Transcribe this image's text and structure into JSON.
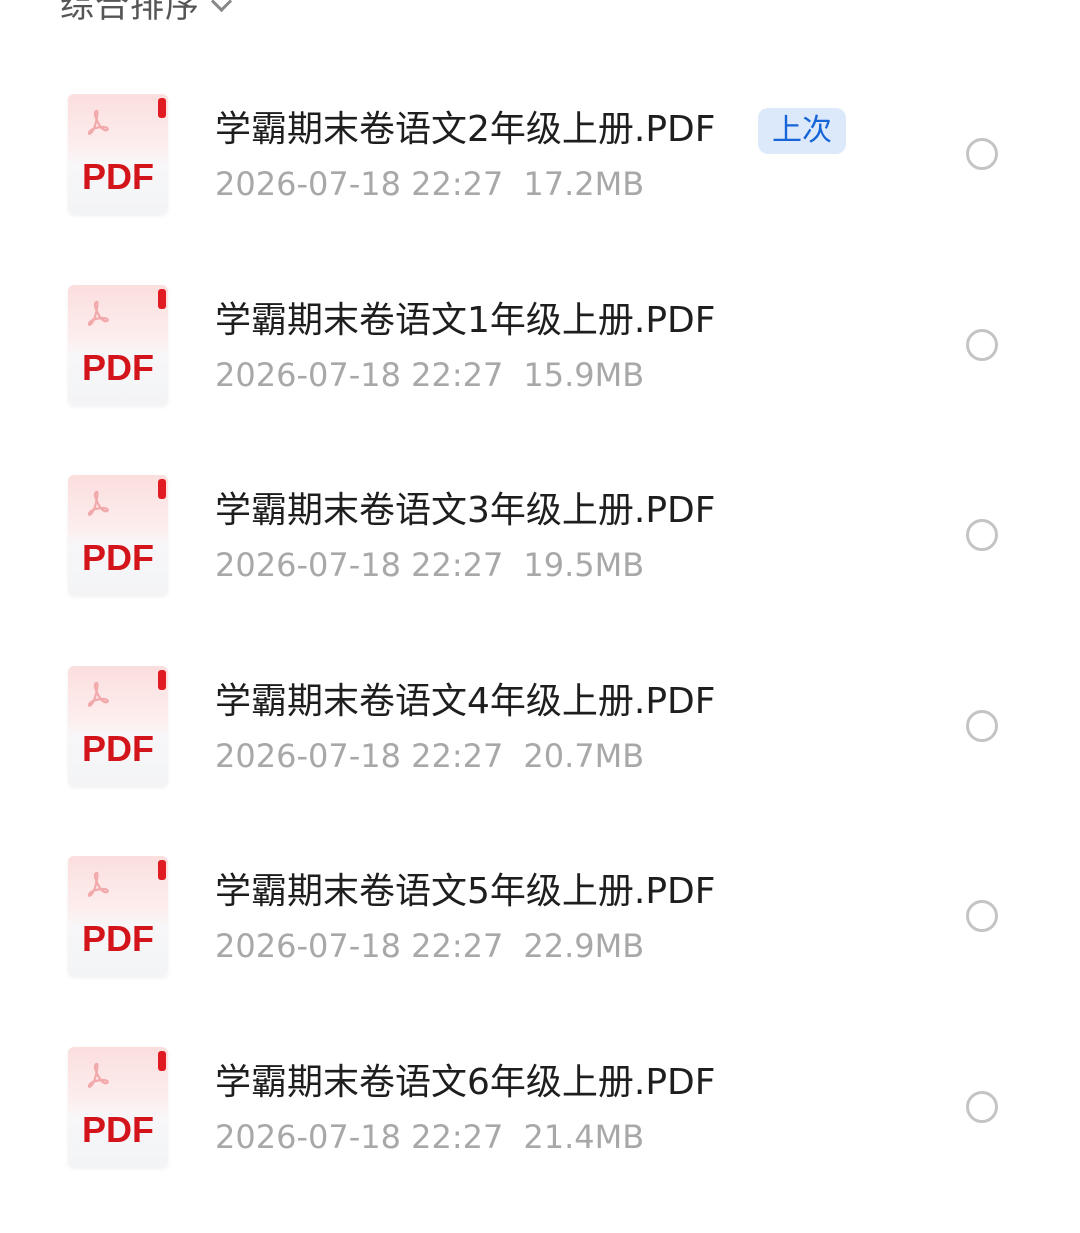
{
  "header": {
    "sort_label": "综合排序",
    "sort_chevron_icon": "chevron-down-icon",
    "view_toggle_icon": "grid-view-icon"
  },
  "files": [
    {
      "name": "学霸期末卷语文2年级上册.PDF",
      "date": "2026-07-18 22:27",
      "size": "17.2MB",
      "badge": "上次",
      "icon": "pdf-file-icon",
      "icon_text": "PDF"
    },
    {
      "name": "学霸期末卷语文1年级上册.PDF",
      "date": "2026-07-18 22:27",
      "size": "15.9MB",
      "badge": null,
      "icon": "pdf-file-icon",
      "icon_text": "PDF"
    },
    {
      "name": "学霸期末卷语文3年级上册.PDF",
      "date": "2026-07-18 22:27",
      "size": "19.5MB",
      "badge": null,
      "icon": "pdf-file-icon",
      "icon_text": "PDF"
    },
    {
      "name": "学霸期末卷语文4年级上册.PDF",
      "date": "2026-07-18 22:27",
      "size": "20.7MB",
      "badge": null,
      "icon": "pdf-file-icon",
      "icon_text": "PDF"
    },
    {
      "name": "学霸期末卷语文5年级上册.PDF",
      "date": "2026-07-18 22:27",
      "size": "22.9MB",
      "badge": null,
      "icon": "pdf-file-icon",
      "icon_text": "PDF"
    },
    {
      "name": "学霸期末卷语文6年级上册.PDF",
      "date": "2026-07-18 22:27",
      "size": "21.4MB",
      "badge": null,
      "icon": "pdf-file-icon",
      "icon_text": "PDF"
    }
  ],
  "colors": {
    "pdf_red": "#d4141b",
    "badge_bg": "#dce9fb",
    "badge_text": "#1565d8",
    "meta_gray": "#a8a8a8"
  }
}
